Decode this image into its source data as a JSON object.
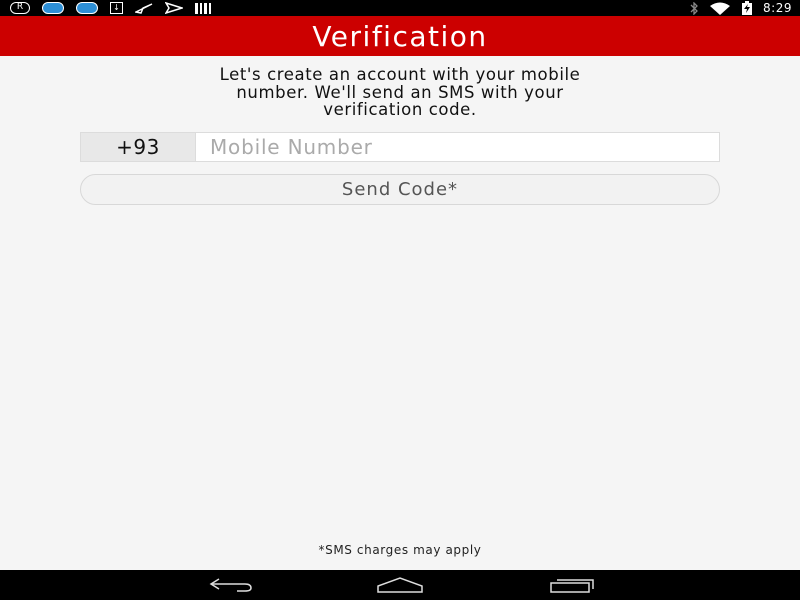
{
  "status_bar": {
    "time": "8:29",
    "left_icons": [
      "registered-icon",
      "sync-icon",
      "sync-icon",
      "download-icon",
      "airplane-icon",
      "send-icon",
      "barcode-icon"
    ],
    "right_icons": [
      "bluetooth-icon",
      "wifi-icon",
      "battery-charging-icon"
    ]
  },
  "header": {
    "title": "Verification",
    "bg_color": "#cc0000"
  },
  "intro": {
    "line1": "Let's create an account with your mobile",
    "line2": "number. We'll send an SMS with your",
    "line3": "verification code."
  },
  "phone": {
    "country_code": "+93",
    "placeholder": "Mobile Number",
    "value": ""
  },
  "send_button": {
    "label": "Send Code*"
  },
  "footnote": "*SMS charges may apply",
  "nav_bar": {
    "buttons": [
      "back-icon",
      "home-icon",
      "recents-icon"
    ]
  }
}
